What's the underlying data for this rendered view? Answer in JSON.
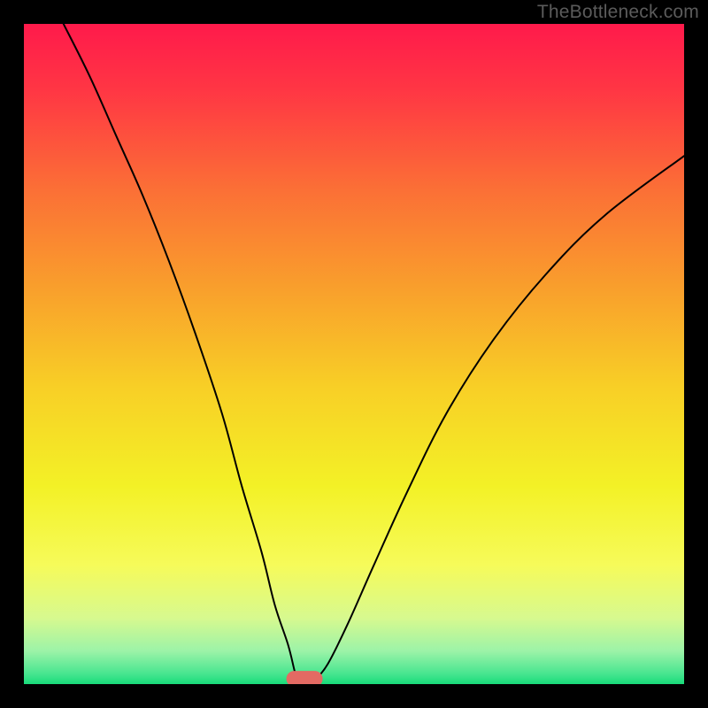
{
  "watermark": "TheBottleneck.com",
  "chart_data": {
    "type": "line",
    "title": "",
    "xlabel": "",
    "ylabel": "",
    "xlim": [
      0,
      100
    ],
    "ylim": [
      0,
      100
    ],
    "grid": false,
    "legend": false,
    "background": {
      "type": "vertical-gradient",
      "stops": [
        {
          "offset": 0.0,
          "color": "#ff1a4b"
        },
        {
          "offset": 0.1,
          "color": "#ff3644"
        },
        {
          "offset": 0.25,
          "color": "#fb6f36"
        },
        {
          "offset": 0.4,
          "color": "#f99f2c"
        },
        {
          "offset": 0.55,
          "color": "#f8cf26"
        },
        {
          "offset": 0.7,
          "color": "#f3f126"
        },
        {
          "offset": 0.82,
          "color": "#f6fb5a"
        },
        {
          "offset": 0.9,
          "color": "#d7f98f"
        },
        {
          "offset": 0.95,
          "color": "#9cf3a8"
        },
        {
          "offset": 0.985,
          "color": "#46e58f"
        },
        {
          "offset": 1.0,
          "color": "#18db79"
        }
      ]
    },
    "series": [
      {
        "name": "left-arm",
        "stroke": "#000000",
        "stroke_width": 2,
        "x": [
          6,
          10,
          14,
          18,
          22,
          26,
          30,
          33,
          36,
          38,
          40,
          41,
          41.5
        ],
        "y": [
          100,
          92,
          83,
          74,
          64,
          53,
          41,
          30,
          20,
          12,
          6,
          2,
          0.5
        ]
      },
      {
        "name": "right-arm",
        "stroke": "#000000",
        "stroke_width": 2,
        "x": [
          44,
          46,
          49,
          53,
          58,
          64,
          71,
          79,
          88,
          100
        ],
        "y": [
          0.5,
          3,
          9,
          18,
          29,
          41,
          52,
          62,
          71,
          80
        ]
      }
    ],
    "marker": {
      "name": "min-marker",
      "shape": "rounded-rect",
      "x": 42.5,
      "y": 0.8,
      "width": 5.5,
      "height": 2.4,
      "color": "#e36a63"
    }
  }
}
